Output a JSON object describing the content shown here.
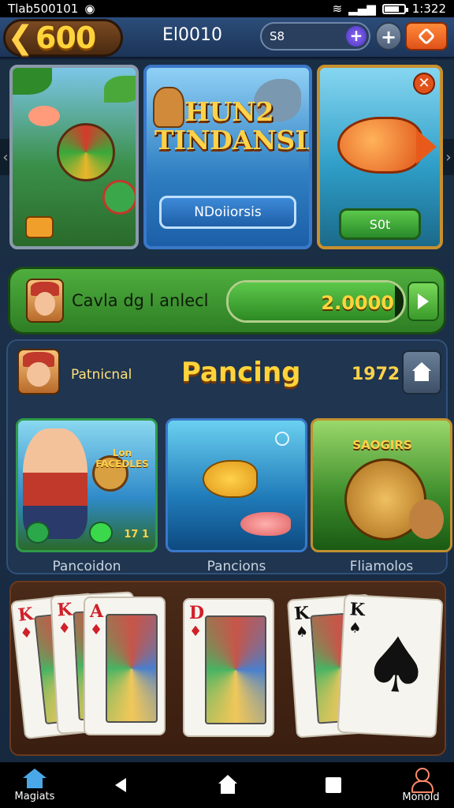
{
  "status_bar": {
    "left_text": "Tlab500101",
    "time": "1:322",
    "battery_level": 0.7
  },
  "header": {
    "coins": "600",
    "title": "El0010",
    "search_value": "S8",
    "plus_label": "+",
    "add_label": "+"
  },
  "carousel": {
    "featured_title": "HUN2 TINDANSIA",
    "featured_button": "NDoiiorsis",
    "right_button": "S0t",
    "close_label": "✕"
  },
  "progress": {
    "label": "Cavla dg l anlecl",
    "value": "2.0000",
    "fill_fraction": 0.95
  },
  "section": {
    "subtitle": "Patnicnal",
    "title": "Pancing",
    "count": "1972",
    "tiles": [
      {
        "label": "Pancoidon",
        "logo": "Lon FACEDLES",
        "number": "17 1"
      },
      {
        "label": "Pancions"
      },
      {
        "label": "Fliamolos",
        "logo": "SAOGIRS"
      }
    ]
  },
  "cards": [
    {
      "rank": "K",
      "suit": "♦",
      "color": "#d0202a"
    },
    {
      "rank": "K",
      "suit": "♦",
      "color": "#d0202a"
    },
    {
      "rank": "A",
      "suit": "♦",
      "color": "#d0202a"
    },
    {
      "rank": "D",
      "suit": "♦",
      "color": "#d0202a"
    },
    {
      "rank": "K",
      "suit": "♠",
      "color": "#111111"
    },
    {
      "rank": "K",
      "suit": "♠",
      "color": "#111111"
    }
  ],
  "nav": {
    "left_label": "Magiats",
    "right_label": "Monold"
  },
  "colors": {
    "accent_gold": "#ffd43b",
    "header_blue": "#1c3457",
    "progress_green": "#2e8a24"
  }
}
